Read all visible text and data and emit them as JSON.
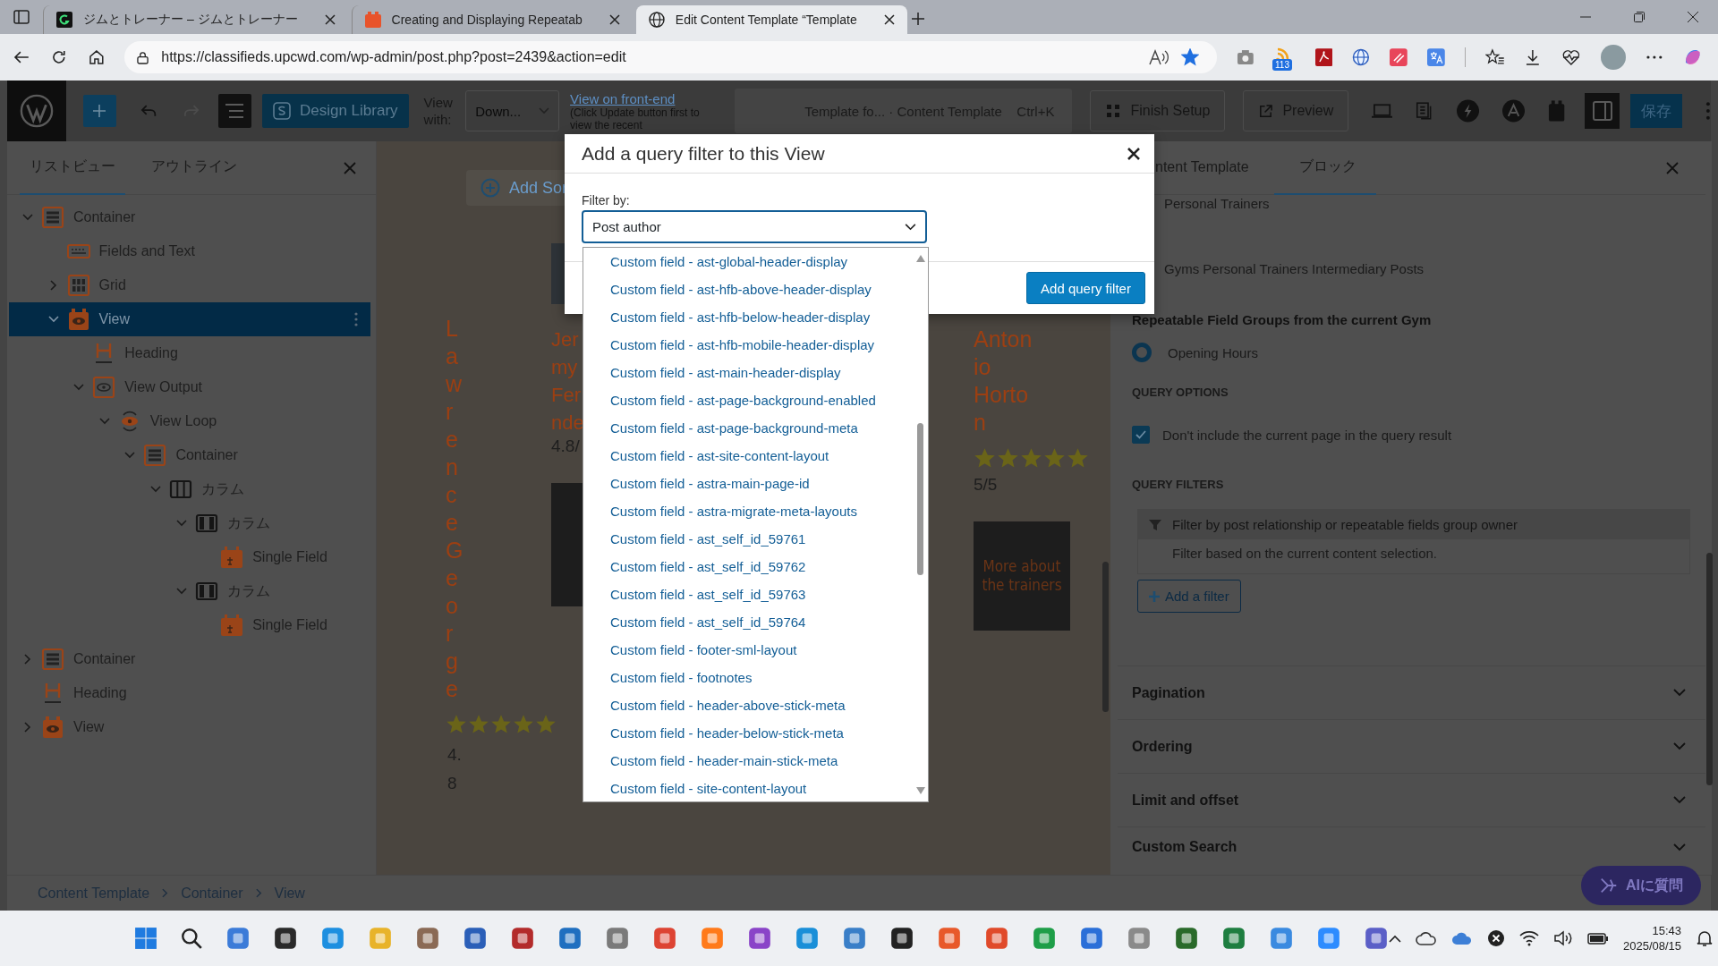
{
  "browser": {
    "tabs": [
      {
        "title": "ジムとトレーナー – ジムとトレーナー",
        "kind": "letter",
        "selected": false
      },
      {
        "title": "Creating and Displaying Repeatab",
        "kind": "block",
        "selected": false
      },
      {
        "title": "Edit Content Template “Template",
        "kind": "globe",
        "selected": true
      }
    ],
    "url": "https://classifieds.upcwd.com/wp-admin/post.php?post=2439&action=edit",
    "bookmarked": true,
    "extension_badge": "113"
  },
  "toolbar": {
    "redo": {
      "disabled": true
    },
    "design_library": "Design Library",
    "view_with_label": "View with:",
    "view_with_value": "Down...",
    "front_end_link": "View on front-end",
    "front_end_note": "(Click Update button first to view the recent",
    "command_title": "Template fo... · Content Template",
    "command_shortcut": "Ctrl+K",
    "finish_setup": "Finish Setup",
    "preview": "Preview",
    "save": "保存"
  },
  "left_panel": {
    "tabs": [
      {
        "label": "リストビュー",
        "selected": true
      },
      {
        "label": "アウトライン",
        "selected": false
      }
    ],
    "tree": [
      {
        "label": "Container",
        "kind": "container",
        "expanded": true,
        "selected": false,
        "children": [
          {
            "label": "Fields and Text",
            "kind": "fields",
            "selected": false
          },
          {
            "label": "Grid",
            "kind": "grid",
            "expanded": false,
            "selected": false
          },
          {
            "label": "View",
            "kind": "view",
            "expanded": true,
            "selected": true,
            "children": [
              {
                "label": "Heading",
                "kind": "heading",
                "selected": false
              },
              {
                "label": "View Output",
                "kind": "view-output",
                "expanded": true,
                "selected": false,
                "children": [
                  {
                    "label": "View Loop",
                    "kind": "view-loop",
                    "expanded": true,
                    "selected": false,
                    "children": [
                      {
                        "label": "Container",
                        "kind": "container",
                        "expanded": true,
                        "selected": false,
                        "children": [
                          {
                            "label": "カラム",
                            "kind": "columns",
                            "expanded": true,
                            "selected": false,
                            "children": [
                              {
                                "label": "カラム",
                                "kind": "column",
                                "expanded": true,
                                "selected": false,
                                "children": [
                                  {
                                    "label": "Single Field",
                                    "kind": "single-field",
                                    "selected": false
                                  }
                                ]
                              },
                              {
                                "label": "カラム",
                                "kind": "column",
                                "expanded": true,
                                "selected": false,
                                "children": [
                                  {
                                    "label": "Single Field",
                                    "kind": "single-field",
                                    "selected": false
                                  }
                                ]
                              }
                            ]
                          }
                        ]
                      }
                    ]
                  }
                ]
              }
            ]
          }
        ]
      },
      {
        "label": "Container",
        "kind": "container",
        "expanded": false,
        "selected": false
      },
      {
        "label": "Heading",
        "kind": "heading",
        "selected": false
      },
      {
        "label": "View",
        "kind": "view",
        "expanded": false,
        "selected": false
      }
    ]
  },
  "canvas": {
    "sort_button": "Add Sor",
    "cards": [
      {
        "kind": "vertical",
        "name": "LawrenceGeorge",
        "stars": 5,
        "rating": "4.8"
      },
      {
        "kind": "lines",
        "name_lines": [
          "Jer",
          "my",
          "Fer",
          "nde"
        ],
        "rating": "4.8/",
        "photo": true
      },
      {
        "kind": "lines",
        "name_lines": [
          "Anton",
          "io",
          "Horto",
          "n"
        ],
        "stars": 5,
        "rating": "5/5",
        "button": "More about the trainers"
      }
    ]
  },
  "modal": {
    "title": "Add a query filter to this View",
    "filter_label": "Filter by:",
    "filter_value": "Post author",
    "submit": "Add query filter",
    "options": [
      {
        "label": "Custom field - ast-global-header-display",
        "selected": false
      },
      {
        "label": "Custom field - ast-hfb-above-header-display",
        "selected": false
      },
      {
        "label": "Custom field - ast-hfb-below-header-display",
        "selected": false
      },
      {
        "label": "Custom field - ast-hfb-mobile-header-display",
        "selected": false
      },
      {
        "label": "Custom field - ast-main-header-display",
        "selected": false
      },
      {
        "label": "Custom field - ast-page-background-enabled",
        "selected": false
      },
      {
        "label": "Custom field - ast-page-background-meta",
        "selected": false
      },
      {
        "label": "Custom field - ast-site-content-layout",
        "selected": false
      },
      {
        "label": "Custom field - astra-main-page-id",
        "selected": false
      },
      {
        "label": "Custom field - astra-migrate-meta-layouts",
        "selected": false
      },
      {
        "label": "Custom field - ast_self_id_59761",
        "selected": false
      },
      {
        "label": "Custom field - ast_self_id_59762",
        "selected": false
      },
      {
        "label": "Custom field - ast_self_id_59763",
        "selected": false
      },
      {
        "label": "Custom field - ast_self_id_59764",
        "selected": false
      },
      {
        "label": "Custom field - footer-sml-layout",
        "selected": false
      },
      {
        "label": "Custom field - footnotes",
        "selected": false
      },
      {
        "label": "Custom field - header-above-stick-meta",
        "selected": false
      },
      {
        "label": "Custom field - header-below-stick-meta",
        "selected": false
      },
      {
        "label": "Custom field - header-main-stick-meta",
        "selected": false
      },
      {
        "label": "Custom field - site-content-layout",
        "selected": false
      }
    ]
  },
  "right_panel": {
    "tabs": [
      {
        "label": "ntent Template",
        "selected": false
      },
      {
        "label": "ブロック",
        "selected": true
      }
    ],
    "relationship_options": [
      "Personal Trainers",
      "Gyms Personal Trainers Intermediary Posts"
    ],
    "repeatable_heading": "Repeatable Field Groups from the current Gym",
    "repeatable_groups": [
      {
        "label": "Opening Hours",
        "selected": true
      }
    ],
    "query_options_heading": "QUERY OPTIONS",
    "query_options": [
      {
        "label": "Don't include the current page in the query result",
        "checked": true
      }
    ],
    "query_filters_heading": "QUERY FILTERS",
    "filter_title": "Filter by post relationship or repeatable fields group owner",
    "filter_description": "Filter based on the current content selection.",
    "add_filter": "Add a filter",
    "sections": [
      {
        "label": "Pagination",
        "expanded": false
      },
      {
        "label": "Ordering",
        "expanded": false
      },
      {
        "label": "Limit and offset",
        "expanded": false
      },
      {
        "label": "Custom Search",
        "expanded": false
      }
    ]
  },
  "breadcrumb": [
    "Content Template",
    "Container",
    "View"
  ],
  "ai_button": "AIに質問",
  "taskbar": {
    "time": "15:43",
    "date": "2025/08/15"
  }
}
